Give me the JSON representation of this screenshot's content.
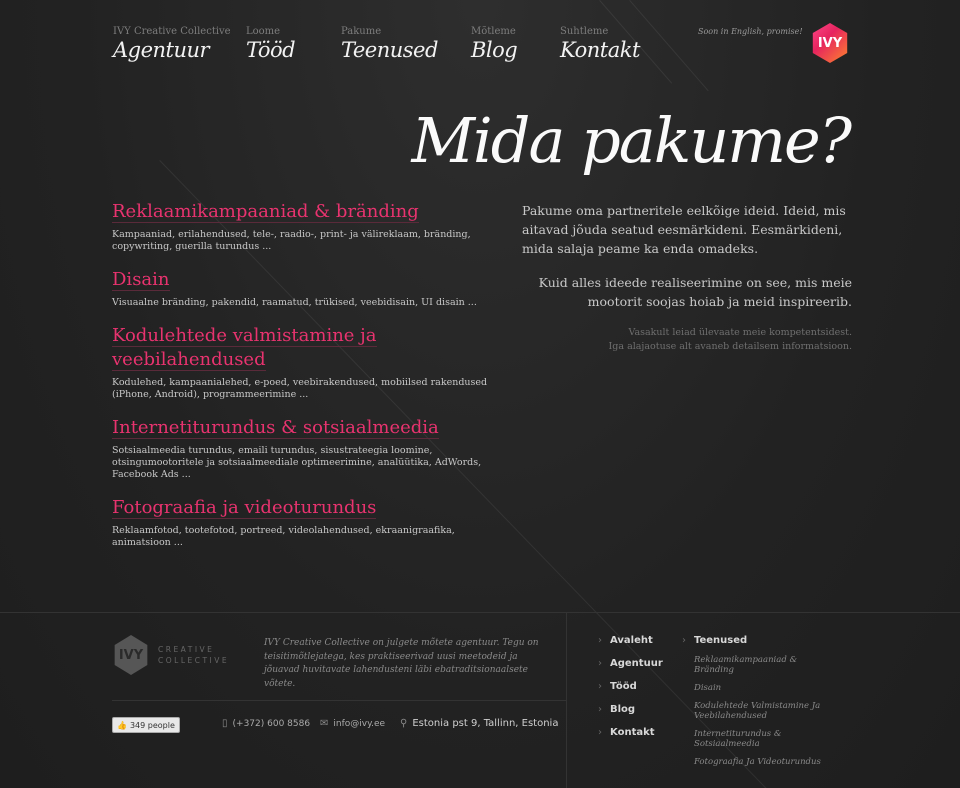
{
  "nav": [
    {
      "small": "IVY Creative Collective",
      "label": "Agentuur"
    },
    {
      "small": "Loome",
      "label": "Tööd"
    },
    {
      "small": "Pakume",
      "label": "Teenused"
    },
    {
      "small": "Mõtleme",
      "label": "Blog"
    },
    {
      "small": "Suhtleme",
      "label": "Kontakt"
    }
  ],
  "header": {
    "english_note": "Soon in English, promise!",
    "logo_text": "IVY"
  },
  "page_title": "Mida pakume?",
  "services": [
    {
      "title": "Reklaamikampaaniad & bränding",
      "desc": "Kampaaniad, erilahendused, tele-, raadio-, print- ja välireklaam, bränding, copywriting, guerilla turundus ..."
    },
    {
      "title": "Disain",
      "desc": "Visuaalne bränding, pakendid, raamatud, trükised, veebidisain, UI disain ..."
    },
    {
      "title": "Kodulehtede valmistamine ja veebilahendused",
      "desc": "Kodulehed, kampaanialehed, e-poed, veebirakendused, mobiilsed rakendused (iPhone, Android), programmeerimine ..."
    },
    {
      "title": "Internetiturundus & sotsiaalmeedia",
      "desc": "Sotsiaalmeedia turundus, emaili turundus, sisustrateegia loomine, otsingumootoritele ja sotsiaalmeediale optimeerimine, analüütika, AdWords, Facebook Ads ..."
    },
    {
      "title": "Fotograafia ja videoturundus",
      "desc": "Reklaamfotod, tootefotod, portreed, videolahendused, ekraanigraafika, animatsioon ..."
    }
  ],
  "intro": {
    "p1": "Pakume oma partneritele eelkõige ideid. Ideid, mis aitavad jõuda seatud eesmärkideni. Eesmärkideni, mida salaja peame ka enda omadeks.",
    "p2": "Kuid alles ideede realiseerimine on see, mis meie mootorit soojas hoiab ja meid inspireerib.",
    "note1": "Vasakult leiad ülevaate meie kompetentsidest.",
    "note2": "Iga alajaotuse alt avaneb detailsem informatsioon."
  },
  "footer": {
    "logo_text": "IVY",
    "logo_line1": "CREATIVE",
    "logo_line2": "COLLECTIVE",
    "blurb": "IVY Creative Collective on julgete mõtete agentuur. Tegu on teisitimõtlejatega, kes praktiseerivad uusi meetodeid ja jõuavad huvitavate lahendusteni läbi ebatraditsionaalsete võtete.",
    "like_count": "349 people",
    "phone": "(+372) 600 8586",
    "email": "info@ivy.ee",
    "address": "Estonia pst 9, Tallinn, Estonia",
    "nav": [
      "Avaleht",
      "Agentuur",
      "Tööd",
      "Blog",
      "Kontakt"
    ],
    "services_head": "Teenused",
    "services": [
      "Reklaamikampaaniad & Bränding",
      "Disain",
      "Kodulehtede Valmistamine Ja Veebilahendused",
      "Internetiturundus & Sotsiaalmeedia",
      "Fotograafia Ja Videoturundus"
    ]
  },
  "colors": {
    "accent": "#e8336f",
    "background": "#242424"
  }
}
